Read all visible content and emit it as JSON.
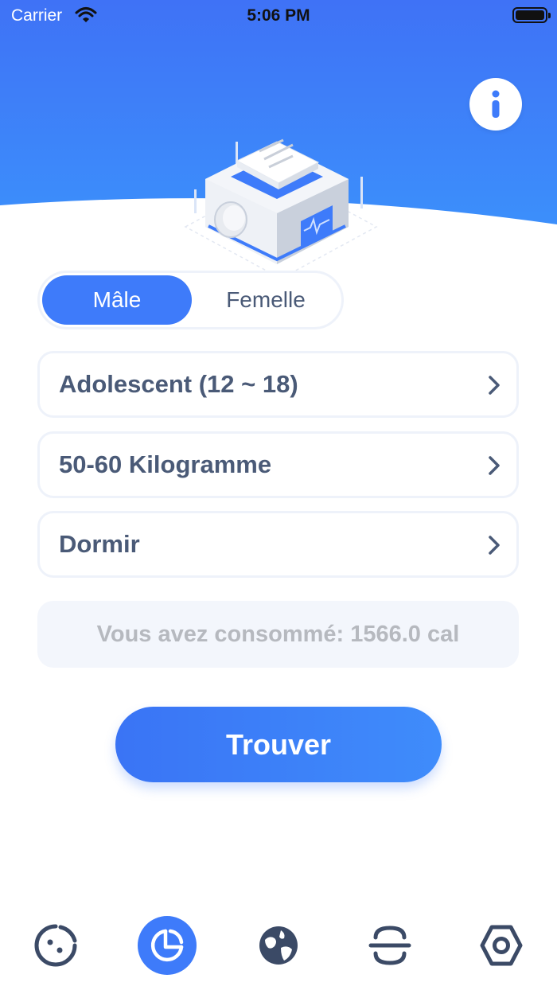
{
  "status_bar": {
    "carrier": "Carrier",
    "time": "5:06 PM"
  },
  "colors": {
    "accent": "#3e7bfa",
    "text": "#4a5a77",
    "muted": "#b6b9bf",
    "border": "#eef2fa"
  },
  "header": {
    "info_icon": "info-icon",
    "illustration": "scale-device-illustration"
  },
  "gender": {
    "options": [
      "Mâle",
      "Femelle"
    ],
    "selected": "Mâle"
  },
  "selectors": [
    {
      "label": "Adolescent (12 ~ 18)",
      "icon": "chevron-right-icon"
    },
    {
      "label": "50-60 Kilogramme",
      "icon": "chevron-right-icon"
    },
    {
      "label": "Dormir",
      "icon": "chevron-right-icon"
    }
  ],
  "result": {
    "text": "Vous avez consommé: 1566.0 cal"
  },
  "action": {
    "label": "Trouver"
  },
  "tabbar": {
    "items": [
      {
        "icon": "cookie-icon",
        "active": false
      },
      {
        "icon": "pie-chart-icon",
        "active": true
      },
      {
        "icon": "globe-icon",
        "active": false
      },
      {
        "icon": "strikethrough-s-icon",
        "active": false
      },
      {
        "icon": "hexagon-nut-icon",
        "active": false
      }
    ]
  }
}
